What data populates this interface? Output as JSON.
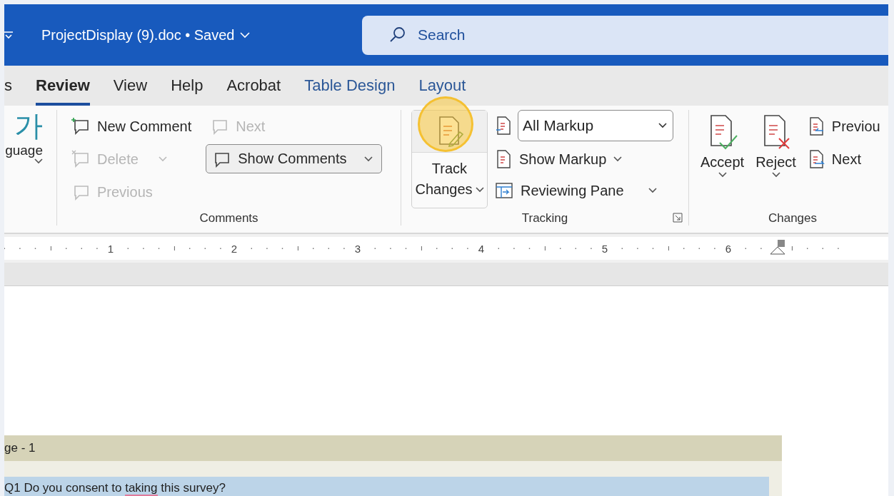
{
  "title_bar": {
    "document": "ProjectDisplay (9).doc • Saved",
    "search_placeholder": "Search"
  },
  "tabs": [
    {
      "label": "s",
      "selected": false,
      "contextual": false
    },
    {
      "label": "Review",
      "selected": true,
      "contextual": false
    },
    {
      "label": "View",
      "selected": false,
      "contextual": false
    },
    {
      "label": "Help",
      "selected": false,
      "contextual": false
    },
    {
      "label": "Acrobat",
      "selected": false,
      "contextual": false
    },
    {
      "label": "Table Design",
      "selected": false,
      "contextual": true
    },
    {
      "label": "Layout",
      "selected": false,
      "contextual": true
    }
  ],
  "language": {
    "glyph": "가",
    "label": "guage"
  },
  "comments": {
    "label": "Comments",
    "new_comment": {
      "label": "New Comment",
      "disabled": false
    },
    "next": {
      "label": "Next",
      "disabled": true
    },
    "delete": {
      "label": "Delete",
      "disabled": true
    },
    "previous": {
      "label": "Previous",
      "disabled": true
    },
    "show_comments": {
      "label": "Show Comments"
    }
  },
  "tracking": {
    "label": "Tracking",
    "track_changes": [
      "Track",
      "Changes"
    ],
    "markup_select": "All Markup",
    "show_markup": "Show Markup",
    "reviewing_pane": "Reviewing Pane"
  },
  "changes": {
    "label": "Changes",
    "accept": "Accept",
    "reject": "Reject",
    "previous": "Previou",
    "next": "Next"
  },
  "ruler": [
    "1",
    "2",
    "3",
    "4",
    "5",
    "6"
  ],
  "document": {
    "section_header": "ge - 1",
    "question": {
      "before": "Q1 Do you consent to ",
      "flagged": "taking",
      "after": " this survey?"
    }
  }
}
